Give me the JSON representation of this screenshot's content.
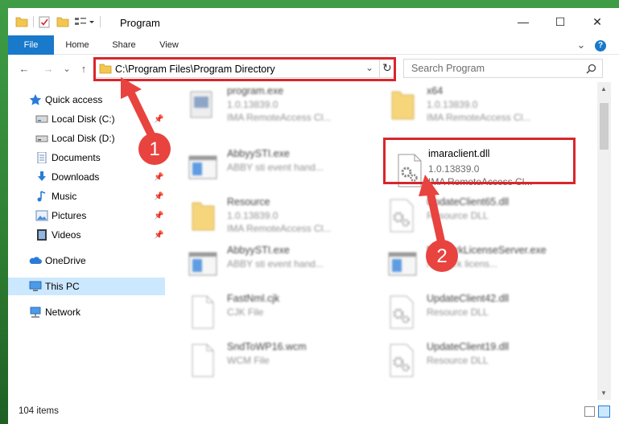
{
  "window": {
    "title": "Program",
    "minimize_label": "—",
    "maximize_label": "☐",
    "close_label": "✕"
  },
  "ribbon": {
    "tabs": [
      {
        "label": "File"
      },
      {
        "label": "Home"
      },
      {
        "label": "Share"
      },
      {
        "label": "View"
      }
    ],
    "expand_label": "⌄",
    "help_label": "?"
  },
  "nav": {
    "back": "←",
    "forward": "→",
    "recent": "⌄",
    "up": "↑",
    "address_path": "C:\\Program Files\\Program Directory",
    "address_dropdown": "⌄",
    "refresh": "↻",
    "search_placeholder": "Search Program"
  },
  "sidebar": {
    "items": [
      {
        "label": "Quick access",
        "icon": "star-icon",
        "pinned": false
      },
      {
        "label": "Local Disk (C:)",
        "icon": "drive-icon",
        "pinned": true
      },
      {
        "label": "Local Disk (D:)",
        "icon": "drive-icon",
        "pinned": false
      },
      {
        "label": "Documents",
        "icon": "documents-icon",
        "pinned": true
      },
      {
        "label": "Downloads",
        "icon": "downloads-icon",
        "pinned": true
      },
      {
        "label": "Music",
        "icon": "music-icon",
        "pinned": true
      },
      {
        "label": "Pictures",
        "icon": "pictures-icon",
        "pinned": true
      },
      {
        "label": "Videos",
        "icon": "videos-icon",
        "pinned": true
      },
      {
        "label": "OneDrive",
        "icon": "onedrive-icon",
        "pinned": false
      },
      {
        "label": "This PC",
        "icon": "this-pc-icon",
        "pinned": false,
        "selected": true
      },
      {
        "label": "Network",
        "icon": "network-icon",
        "pinned": false
      }
    ]
  },
  "files": [
    {
      "name": "program.exe",
      "line2": "1.0.13839.0",
      "line3": "IMA RemoteAccess Cl...",
      "icon": "exe-icon"
    },
    {
      "name": "x64",
      "line2": "1.0.13839.0",
      "line3": "IMA RemoteAccess Cl...",
      "icon": "folder-icon"
    },
    {
      "name": "AbbyySTI.exe",
      "line2": "ABBY sti event hand...",
      "line3": "",
      "icon": "app-window-icon"
    },
    {
      "name": "imaraclient.dll",
      "line2": "1.0.13839.0",
      "line3": "IMA RemoteAccess Cl...",
      "icon": "dll-gear-icon"
    },
    {
      "name": "Resource",
      "line2": "1.0.13839.0",
      "line3": "IMA RemoteAccess Cl...",
      "icon": "folder-icon"
    },
    {
      "name": "UpdateClient65.dll",
      "line2": "Resource DLL",
      "line3": "",
      "icon": "dll-gear-icon"
    },
    {
      "name": "AbbyySTI.exe",
      "line2": "ABBY sti event hand...",
      "line3": "",
      "icon": "app-window-icon"
    },
    {
      "name": "NetworkLicenseServer.exe",
      "line2": "Network licens...",
      "line3": "",
      "icon": "app-window-icon"
    },
    {
      "name": "FastNml.cjk",
      "line2": "CJK File",
      "line3": "",
      "icon": "blank-file-icon"
    },
    {
      "name": "UpdateClient42.dll",
      "line2": "Resource DLL",
      "line3": "",
      "icon": "dll-gear-icon"
    },
    {
      "name": "SndToWP16.wcm",
      "line2": "WCM File",
      "line3": "",
      "icon": "blank-file-icon"
    },
    {
      "name": "UpdateClient19.dll",
      "line2": "Resource DLL",
      "line3": "",
      "icon": "dll-gear-icon"
    }
  ],
  "status": {
    "item_count": "104 items"
  },
  "annotations": {
    "step1": "1",
    "step2": "2"
  },
  "colors": {
    "accent": "#1979ca",
    "highlight_red": "#d9262b",
    "selection": "#cce8ff"
  }
}
